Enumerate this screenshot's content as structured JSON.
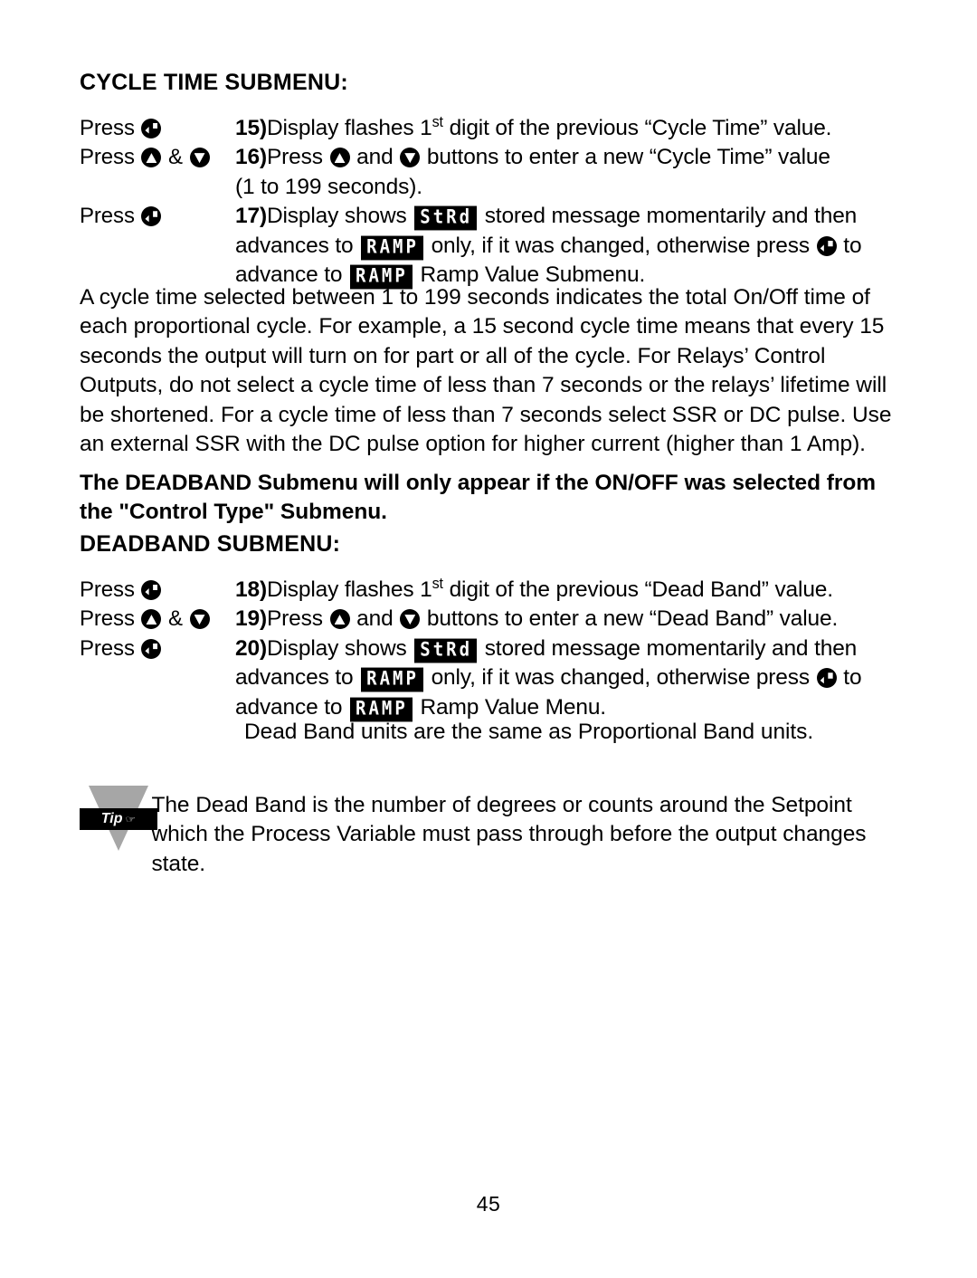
{
  "document": {
    "page_number": "45"
  },
  "cycle_time": {
    "heading": "CYCLE TIME SUBMENU:",
    "steps": [
      {
        "press_label": "Press",
        "buttons": [
          "enter"
        ],
        "number": "15)",
        "lines": [
          "Display flashes 1st digit of the previous “Cycle Time” value."
        ]
      },
      {
        "press_label": "Press",
        "buttons": [
          "up",
          "down"
        ],
        "separator": "&",
        "number": "16)",
        "lines": [
          "Press  and  buttons to enter a new “Cycle Time” value",
          "(1 to 199 seconds)."
        ]
      },
      {
        "press_label": "Press",
        "buttons": [
          "enter"
        ],
        "number": "17)",
        "lines": [
          "Display shows StRd stored message momentarily and then",
          "advances to RAMP only, if it was changed, otherwise press  to",
          "advance to RAMP Ramp Value Submenu."
        ]
      }
    ]
  },
  "cycle_time_paragraph": "A cycle time selected between 1 to 199 seconds indicates the total On/Off time of each proportional cycle. For example, a 15 second cycle time means that every 15 seconds the output will turn on for part or all of the cycle. For Relays’ Control Outputs, do not select a cycle time of less than 7 seconds or the relays’ lifetime will be shortened. For a cycle time of less than 7 seconds select SSR or DC pulse. Use an external SSR with the DC pulse option for higher current (higher than 1 Amp).",
  "deadband_note": "The DEADBAND Submenu will only appear if the ON/OFF was selected from the \"Control Type\" Submenu.",
  "deadband": {
    "heading": "DEADBAND SUBMENU:",
    "steps": [
      {
        "press_label": "Press",
        "buttons": [
          "enter"
        ],
        "number": "18)",
        "lines": [
          "Display flashes 1st digit of the previous “Dead Band” value."
        ]
      },
      {
        "press_label": "Press",
        "buttons": [
          "up",
          "down"
        ],
        "separator": "&",
        "number": "19)",
        "lines": [
          "Press  and  buttons to enter a new “Dead Band” value."
        ]
      },
      {
        "press_label": "Press",
        "buttons": [
          "enter"
        ],
        "number": "20)",
        "lines": [
          "Display shows StRd stored message momentarily and then",
          "advances to RAMP only, if it was changed, otherwise press  to",
          "advance to RAMP Ramp Value Menu."
        ]
      }
    ],
    "units_note": "Dead Band units are the same as Proportional Band units."
  },
  "tip": {
    "label": "Tip",
    "hand_glyph": "☞",
    "text": "The Dead Band is the number of degrees or counts around the Setpoint which the Process Variable must pass through before the output changes state."
  },
  "text_fragments": {
    "press": "Press",
    "amp": "&",
    "step15_a": "Display flashes 1",
    "step15_sup": "st",
    "step15_b": " digit of the previous “Cycle Time” value.",
    "step15_num": "15)",
    "step16_num": "16)",
    "step16_a": "Press ",
    "step16_b": " and ",
    "step16_c": " buttons to enter a new “Cycle Time” value",
    "step16_line2": "(1 to 199 seconds).",
    "step17_num": "17)",
    "step17_a": "Display shows ",
    "step17_b": " stored message momentarily and then",
    "step17_line2a": "advances to ",
    "step17_line2b": " only, if it was changed, otherwise press ",
    "step17_line2c": " to",
    "step17_line3a": "advance to ",
    "step17_line3b": " Ramp Value Submenu.",
    "step18_num": "18)",
    "step18_a": "Display flashes 1",
    "step18_sup": "st",
    "step18_b": " digit of the previous “Dead Band” value.",
    "step19_num": "19)",
    "step19_a": "Press ",
    "step19_b": " and ",
    "step19_c": " buttons to enter a new “Dead Band” value.",
    "step20_num": "20)",
    "step20_a": "Display shows ",
    "step20_b": " stored message momentarily and then",
    "step20_line2a": "advances to ",
    "step20_line2b": " only, if it was changed, otherwise press ",
    "step20_line2c": " to",
    "step20_line3a": "advance to ",
    "step20_line3b": " Ramp Value Menu."
  },
  "led_labels": {
    "stored": "StRd",
    "ramp": "RAMP"
  },
  "colors": {
    "text": "#000000",
    "background": "#ffffff",
    "led_background": "#000000",
    "led_text": "#ffffff",
    "tip_triangle": "#a6a6a6"
  }
}
